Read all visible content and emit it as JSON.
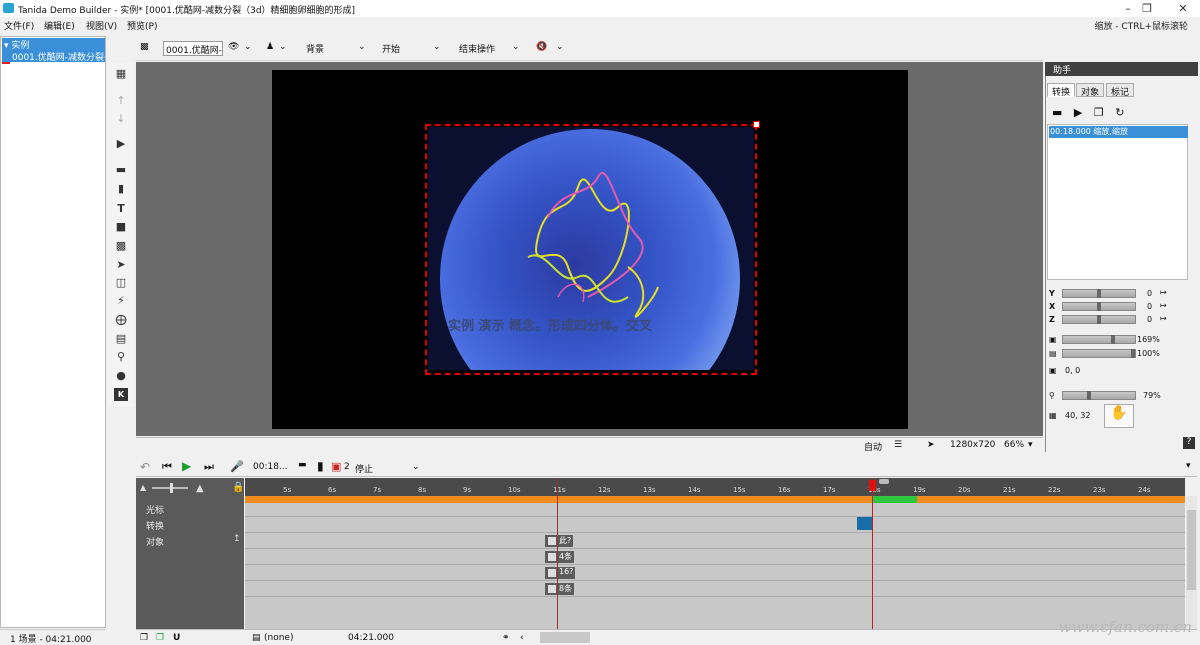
{
  "window": {
    "title": "Tanida Demo Builder - 实例* [0001.优酷网-减数分裂（3d）精细胞卵细胞的形成]",
    "hint": "缩放 - CTRL+鼠标滚轮"
  },
  "menu": [
    "文件(F)",
    "编辑(E)",
    "视图(V)",
    "预览(P)"
  ],
  "tree": {
    "root": "实例",
    "child": "0001.优酷网-减数分裂("
  },
  "left_status": "1 场景 - 04:21.000",
  "toolbar": {
    "scene_name": "0001.优酷网-1",
    "background_label": "背景",
    "start_label": "开始",
    "end_action_label": "结束操作"
  },
  "movie_subtitle": "实例 演示 概念。形成四分体。交叉",
  "canvas_status": {
    "mode": "自动",
    "resolution": "1280x720",
    "zoom": "66%"
  },
  "right_panel": {
    "title": "助手",
    "tabs": [
      "转换",
      "对象",
      "标记"
    ],
    "list_entry": "00:18.000 缩放,缩放",
    "axes": [
      {
        "label": "Y",
        "value": "0",
        "fill": 0.5
      },
      {
        "label": "X",
        "value": "0",
        "fill": 0.5
      },
      {
        "label": "Z",
        "value": "0",
        "fill": 0.5
      }
    ],
    "scale1": {
      "value": "169%",
      "fill": 0.7
    },
    "scale2": {
      "value": "100%",
      "fill": 1.0
    },
    "position": "0, 0",
    "zoom": {
      "value": "79%",
      "fill": 0.35
    },
    "coords": "40, 32"
  },
  "timeline": {
    "time": "00:18...",
    "marker_count": "2",
    "stop_label": "停止",
    "ticks": [
      "5s",
      "6s",
      "7s",
      "8s",
      "9s",
      "10s",
      "11s",
      "12s",
      "13s",
      "14s",
      "15s",
      "16s",
      "17s",
      "18s",
      "19s",
      "20s",
      "21s",
      "22s",
      "23s",
      "24s"
    ],
    "track_labels": [
      "光标",
      "转换",
      "对象"
    ],
    "objects": [
      "此?",
      "4条",
      "16?",
      "8条"
    ]
  },
  "bottom_status": {
    "audio": "(none)",
    "duration": "04:21.000"
  },
  "watermark": "www.cfan.com.cn"
}
